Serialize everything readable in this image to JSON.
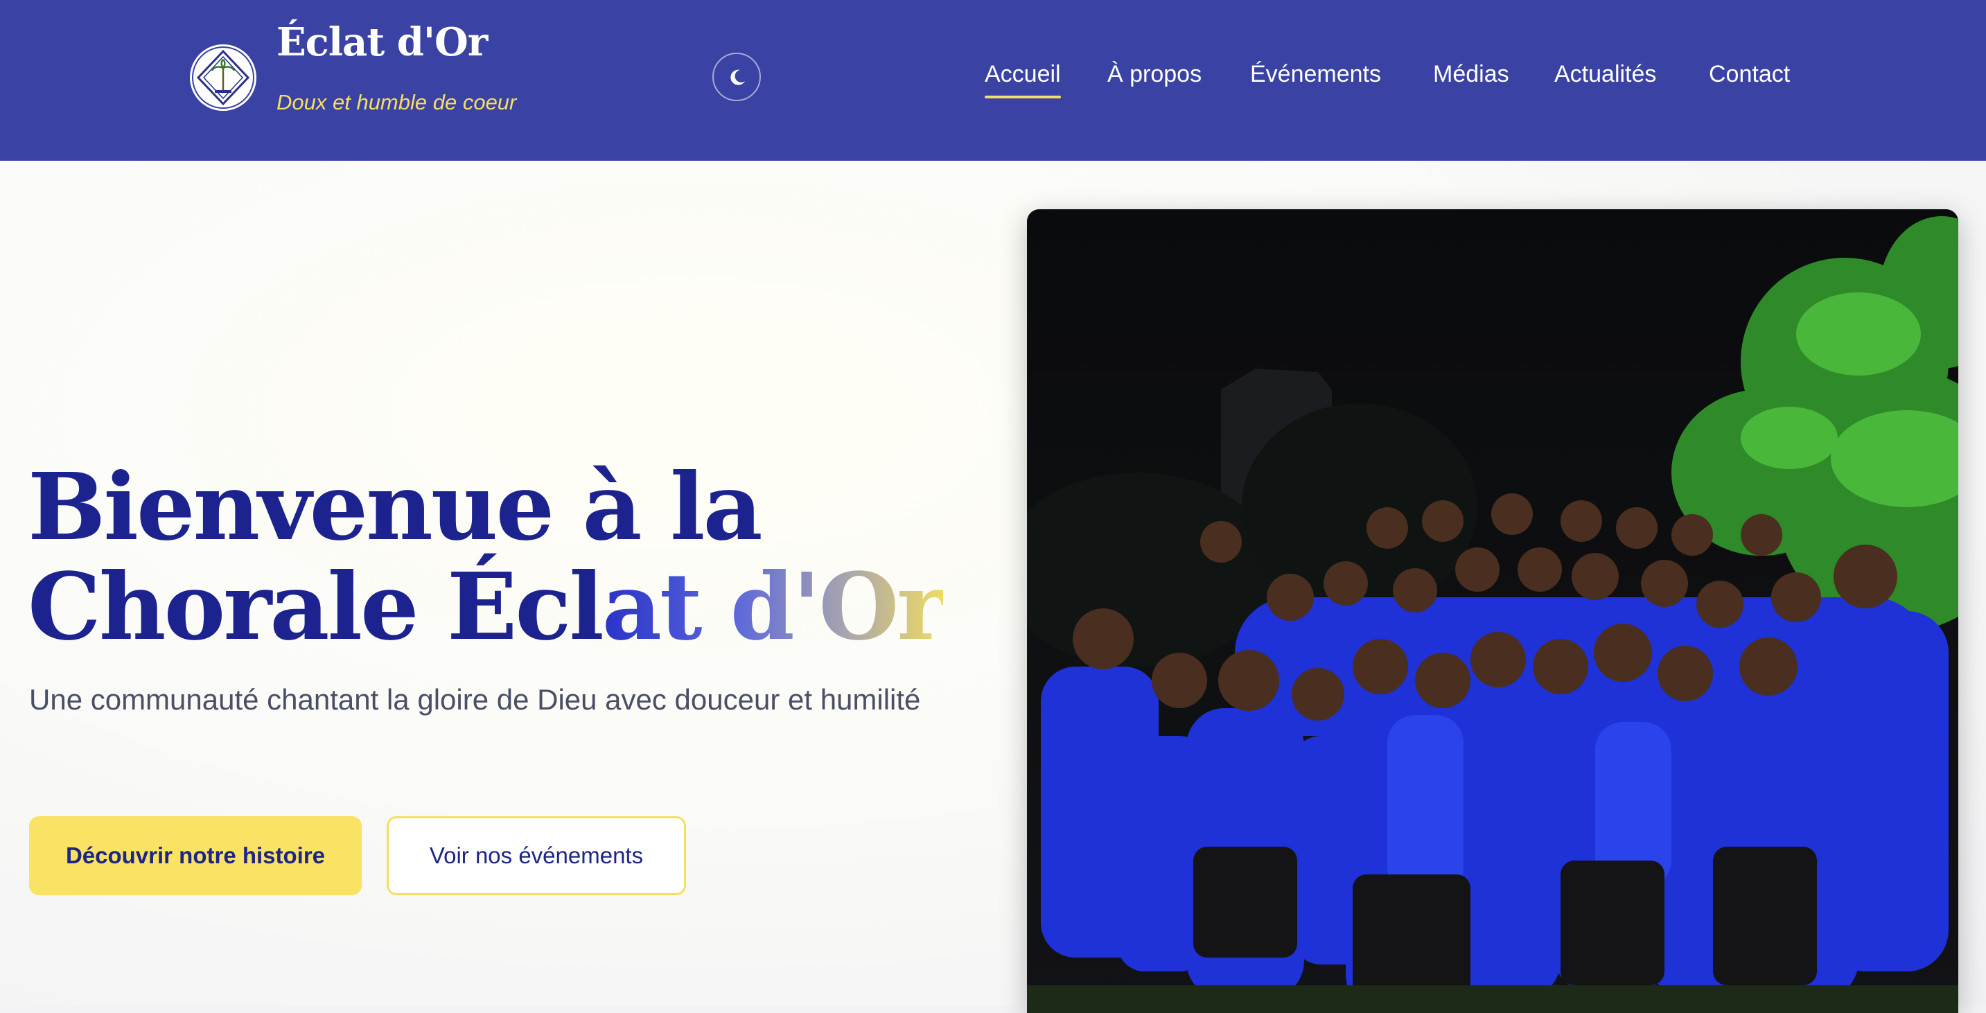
{
  "brand": {
    "title": "Éclat d'Or",
    "tagline": "Doux et humble de coeur",
    "logo_icon": "choir-emblem-icon"
  },
  "theme_toggle": {
    "icon": "moon-icon"
  },
  "nav": {
    "items": [
      {
        "label": "Accueil",
        "active": true
      },
      {
        "label": "À propos",
        "active": false
      },
      {
        "label": "Événements",
        "active": false
      },
      {
        "label": "Médias",
        "active": false
      },
      {
        "label": "Actualités",
        "active": false
      },
      {
        "label": "Contact",
        "active": false
      }
    ]
  },
  "hero": {
    "title_line1": "Bienvenue à la",
    "title_line2_prefix": "Chorale Écl",
    "title_line2_gradient": "at d'Or",
    "subtitle": "Une communauté chantant la gloire de Dieu avec douceur et humilité",
    "primary_button": "Découvrir notre histoire",
    "secondary_button": "Voir nos événements"
  },
  "colors": {
    "header_bg": "#3a43a3",
    "accent_yellow": "#f5df63",
    "title_navy": "#1c238f",
    "button_yellow": "#f9e264"
  }
}
